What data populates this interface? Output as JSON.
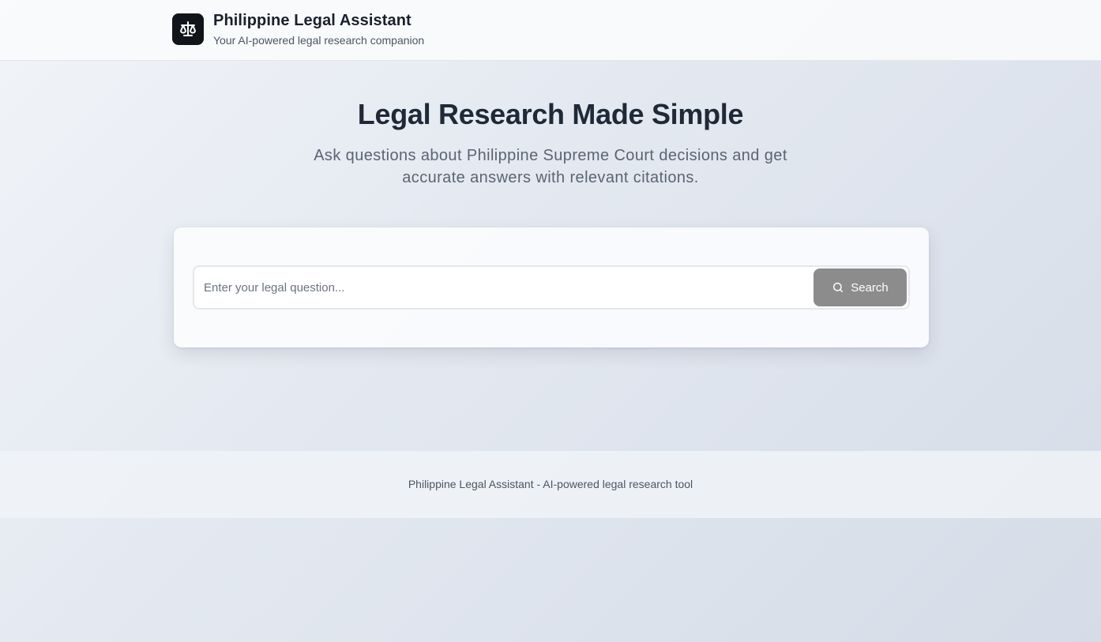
{
  "header": {
    "title": "Philippine Legal Assistant",
    "subtitle": "Your AI-powered legal research companion",
    "logo_icon": "scale-icon"
  },
  "hero": {
    "title": "Legal Research Made Simple",
    "description": "Ask questions about Philippine Supreme Court decisions and get accurate answers with relevant citations."
  },
  "search": {
    "placeholder": "Enter your legal question...",
    "value": "",
    "button_label": "Search",
    "button_icon": "search-icon",
    "button_color": "#8c8c8c"
  },
  "footer": {
    "text": "Philippine Legal Assistant - AI-powered legal research tool"
  },
  "colors": {
    "logo_background": "#111418",
    "title_text": "#1f2937"
  }
}
